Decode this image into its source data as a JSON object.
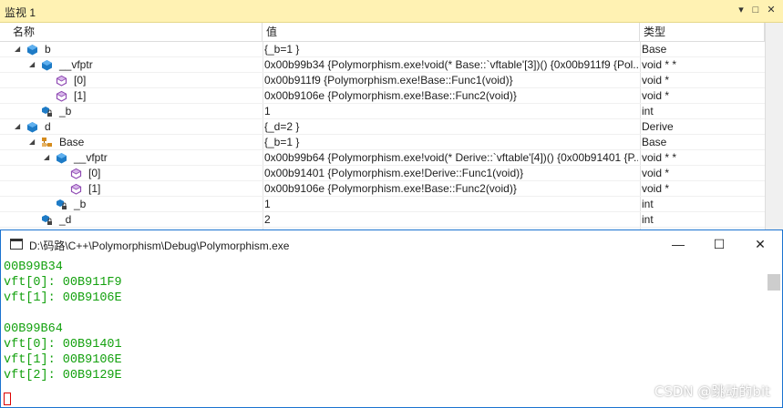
{
  "watch": {
    "title": "监视 1",
    "dropdown_glyph": "▾",
    "restore_glyph": "□",
    "close_glyph": "✕",
    "columns": {
      "name": "名称",
      "value": "值",
      "type": "类型"
    },
    "rows": [
      {
        "name": "b",
        "value": "{_b=1 }",
        "type": "Base",
        "icon": "object-icon",
        "expand": "expanded"
      },
      {
        "name": "__vfptr",
        "value": "0x00b99b34 {Polymorphism.exe!void(* Base::`vftable'[3])() {0x00b911f9 {Pol...",
        "type": "void * *",
        "icon": "object-icon",
        "expand": "expanded"
      },
      {
        "name": "[0]",
        "value": "0x00b911f9 {Polymorphism.exe!Base::Func1(void)}",
        "type": "void *",
        "icon": "pointer-icon",
        "expand": "none"
      },
      {
        "name": "[1]",
        "value": "0x00b9106e {Polymorphism.exe!Base::Func2(void)}",
        "type": "void *",
        "icon": "pointer-icon",
        "expand": "none"
      },
      {
        "name": "_b",
        "value": "1",
        "type": "int",
        "icon": "private-field-icon",
        "expand": "none"
      },
      {
        "name": "d",
        "value": "{_d=2 }",
        "type": "Derive",
        "icon": "object-icon",
        "expand": "expanded"
      },
      {
        "name": "Base",
        "value": "{_b=1 }",
        "type": "Base",
        "icon": "base-class-icon",
        "expand": "expanded"
      },
      {
        "name": "__vfptr",
        "value": "0x00b99b64 {Polymorphism.exe!void(* Derive::`vftable'[4])() {0x00b91401 {P...",
        "type": "void * *",
        "icon": "object-icon",
        "expand": "expanded"
      },
      {
        "name": "[0]",
        "value": "0x00b91401 {Polymorphism.exe!Derive::Func1(void)}",
        "type": "void *",
        "icon": "pointer-icon",
        "expand": "none"
      },
      {
        "name": "[1]",
        "value": "0x00b9106e {Polymorphism.exe!Base::Func2(void)}",
        "type": "void *",
        "icon": "pointer-icon",
        "expand": "none"
      },
      {
        "name": "_b",
        "value": "1",
        "type": "int",
        "icon": "private-field-icon",
        "expand": "none"
      },
      {
        "name": "_d",
        "value": "2",
        "type": "int",
        "icon": "private-field-icon",
        "expand": "none"
      }
    ]
  },
  "console": {
    "title": "D:\\码路\\C++\\Polymorphism\\Debug\\Polymorphism.exe",
    "minimize_glyph": "—",
    "maximize_glyph": "☐",
    "close_glyph": "✕",
    "lines": [
      "00B99B34",
      "vft[0]: 00B911F9",
      "vft[1]: 00B9106E",
      "",
      "00B99B64",
      "vft[0]: 00B91401",
      "vft[1]: 00B9106E",
      "vft[2]: 00B9129E"
    ],
    "text_color": "#13a10e"
  },
  "watermark": "CSDN @跳动的bit",
  "colors": {
    "watch_title_bg": "#fff2b3",
    "console_border": "#1a73d0"
  }
}
